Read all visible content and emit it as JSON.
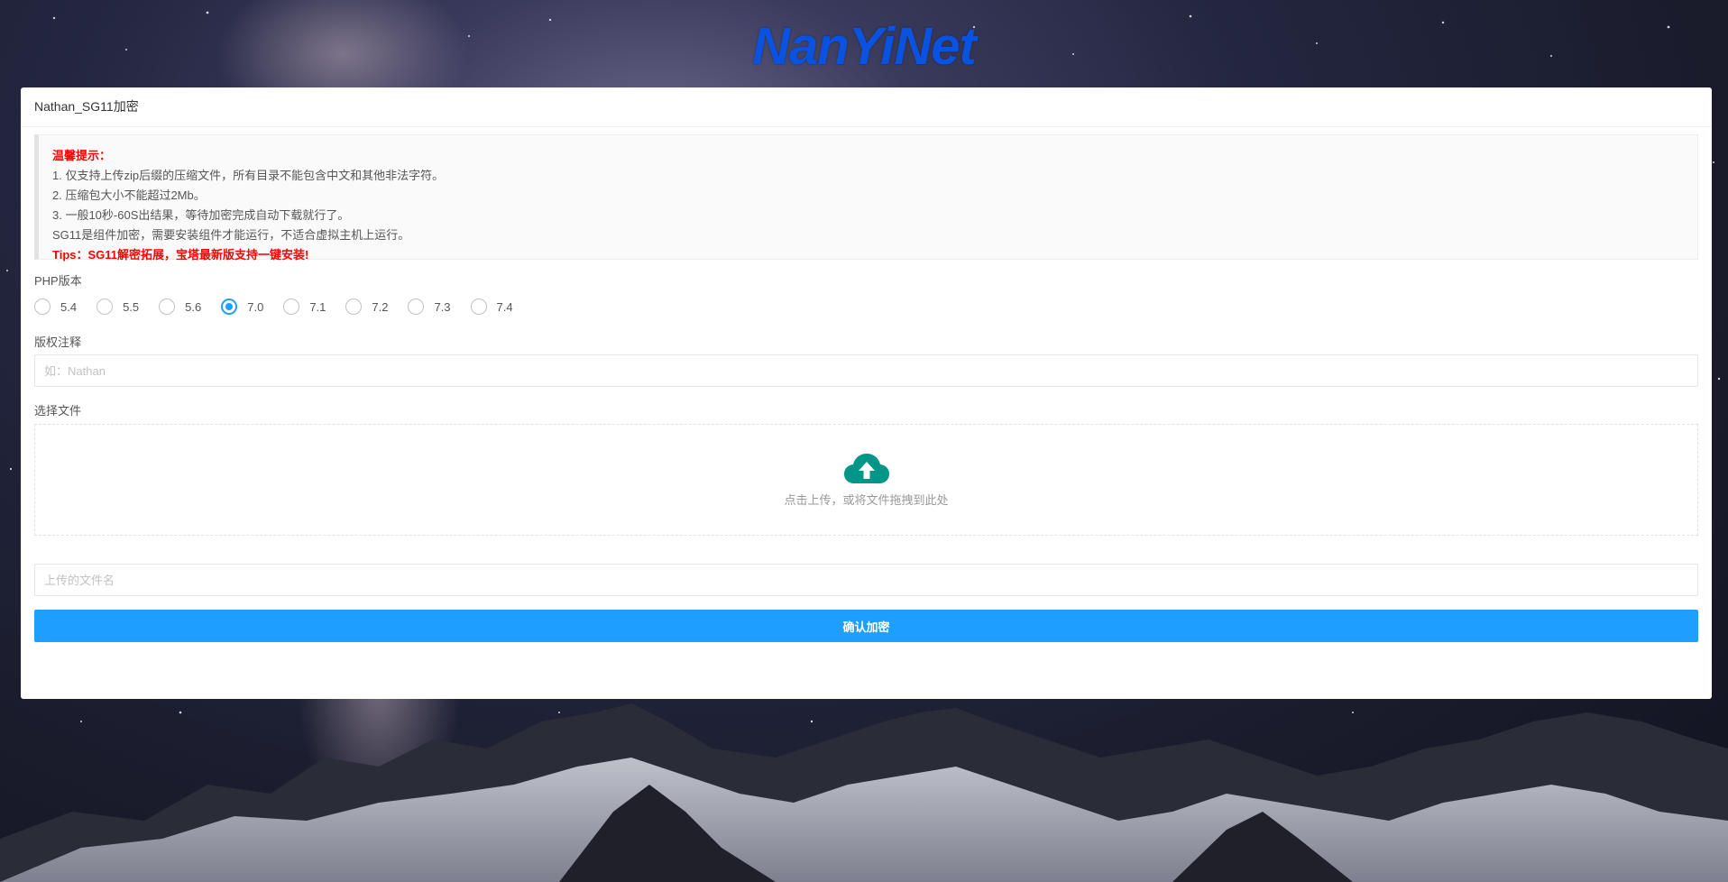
{
  "logo": {
    "text": "NanYiNet",
    "color": "#0a52e0"
  },
  "card": {
    "title": "Nathan_SG11加密"
  },
  "notice": {
    "heading": "温馨提示：",
    "line1": "1. 仅支持上传zip后缀的压缩文件，所有目录不能包含中文和其他非法字符。",
    "line2": "2. 压缩包大小不能超过2Mb。",
    "line3": "3. 一般10秒-60S出结果，等待加密完成自动下载就行了。",
    "line4": "SG11是组件加密，需要安装组件才能运行，不适合虚拟主机上运行。",
    "tips": "Tips：SG11解密拓展，宝塔最新版支持一键安装!"
  },
  "php": {
    "label": "PHP版本",
    "options": [
      "5.4",
      "5.5",
      "5.6",
      "7.0",
      "7.1",
      "7.2",
      "7.3",
      "7.4"
    ],
    "selected": "7.0"
  },
  "copyright": {
    "label": "版权注释",
    "placeholder": "如：Nathan",
    "value": ""
  },
  "file": {
    "label": "选择文件",
    "upload_text": "点击上传，或将文件拖拽到此处",
    "upload_icon": "cloud-upload-icon",
    "upload_icon_color": "#009688"
  },
  "filename": {
    "placeholder": "上传的文件名",
    "value": ""
  },
  "submit": {
    "label": "确认加密",
    "color": "#1e9fff"
  },
  "colors": {
    "accent": "#1e9fff",
    "warning": "#ff0000"
  }
}
